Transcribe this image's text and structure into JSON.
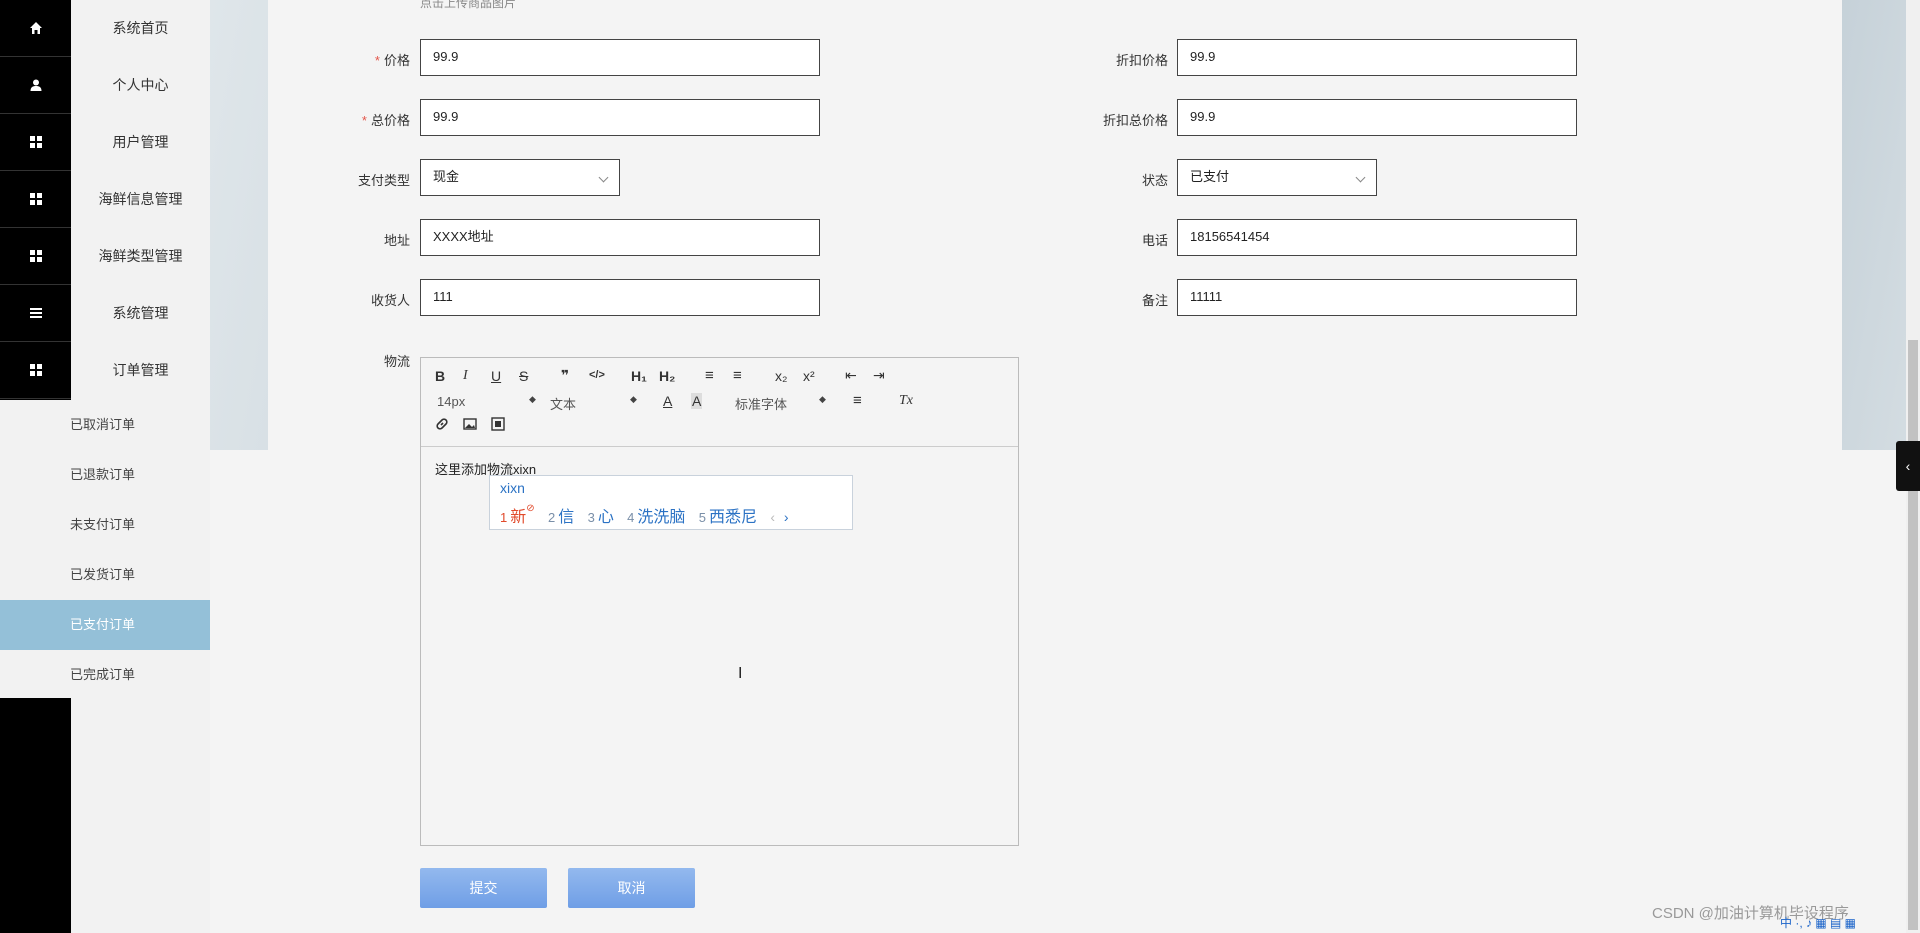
{
  "sidebar": {
    "items": [
      {
        "label": "系统首页",
        "icon": "home-icon"
      },
      {
        "label": "个人中心",
        "icon": "user-icon"
      },
      {
        "label": "用户管理",
        "icon": "grid-icon"
      },
      {
        "label": "海鲜信息管理",
        "icon": "grid-icon"
      },
      {
        "label": "海鲜类型管理",
        "icon": "grid-icon"
      },
      {
        "label": "系统管理",
        "icon": "list-icon"
      },
      {
        "label": "订单管理",
        "icon": "grid-icon"
      }
    ],
    "submenu": [
      {
        "label": "已取消订单"
      },
      {
        "label": "已退款订单"
      },
      {
        "label": "未支付订单"
      },
      {
        "label": "已发货订单"
      },
      {
        "label": "已支付订单",
        "active": true
      },
      {
        "label": "已完成订单"
      }
    ]
  },
  "form": {
    "upload_hint": "点击上传商品图片",
    "price": {
      "label": "价格",
      "value": "99.9"
    },
    "discount_price": {
      "label": "折扣价格",
      "value": "99.9"
    },
    "total_price": {
      "label": "总价格",
      "value": "99.9"
    },
    "discount_total_price": {
      "label": "折扣总价格",
      "value": "99.9"
    },
    "pay_type": {
      "label": "支付类型",
      "value": "现金"
    },
    "status": {
      "label": "状态",
      "value": "已支付"
    },
    "address": {
      "label": "地址",
      "value": "XXXX地址"
    },
    "phone": {
      "label": "电话",
      "value": "18156541454"
    },
    "receiver": {
      "label": "收货人",
      "value": "111"
    },
    "remark": {
      "label": "备注",
      "value": "11111"
    },
    "logistics": {
      "label": "物流"
    },
    "required_mark": "*"
  },
  "editor": {
    "toolbar": {
      "bold": "B",
      "italic": "I",
      "underline": "U",
      "strike": "S",
      "quote": "❞",
      "code": "</>",
      "h1": "H₁",
      "h2": "H₂",
      "ordered": "≡",
      "bullet": "≡",
      "sub": "x₂",
      "sup": "x²",
      "outdent": "⇤",
      "indent": "⇥",
      "size": "14px",
      "format": "文本",
      "color": "A",
      "bg": "A",
      "font": "标准字体",
      "align": "≡",
      "clean": "Tx"
    },
    "content": "这里添加物流xixn",
    "ime": {
      "composition": "xixn",
      "candidates": [
        {
          "n": "1",
          "text": "新"
        },
        {
          "n": "2",
          "text": "信"
        },
        {
          "n": "3",
          "text": "心"
        },
        {
          "n": "4",
          "text": "洗洗脑"
        },
        {
          "n": "5",
          "text": "西悉尼"
        }
      ],
      "prev": "‹",
      "next": "›"
    }
  },
  "buttons": {
    "submit": "提交",
    "cancel": "取消"
  },
  "watermark": "CSDN @加油计算机毕设程序",
  "tray": "中 ·, ♪ ▦ ▤ ▦"
}
